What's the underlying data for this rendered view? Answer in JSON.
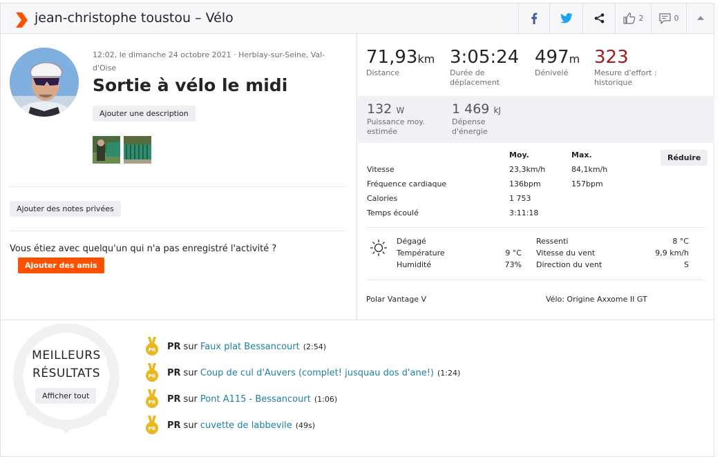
{
  "header": {
    "title": "jean-christophe toustou – Vélo",
    "kudos_count": "2",
    "comments_count": "0"
  },
  "activity": {
    "meta": "12:02, le dimanche 24 octobre 2021 · Herblay-sur-Seine, Val-d'Oise",
    "title": "Sortie à vélo le midi",
    "add_description": "Ajouter une description",
    "add_private_notes": "Ajouter des notes privées",
    "with_question": "Vous étiez avec quelqu'un qui n'a pas enregistré l'activité ?",
    "add_friends": "Ajouter des amis"
  },
  "stats": {
    "distance": {
      "value": "71,93",
      "unit": "km",
      "label": "Distance"
    },
    "moving_time": {
      "value": "3:05:24",
      "label": "Durée de déplacement"
    },
    "elevation": {
      "value": "497",
      "unit": "m",
      "label": "Dénivelé"
    },
    "effort": {
      "value": "323",
      "label": "Mesure d'effort : historique"
    },
    "power": {
      "value": "132",
      "unit": "W",
      "label": "Puissance moy. estimée"
    },
    "energy": {
      "value": "1 469",
      "unit": "kJ",
      "label": "Dépense d'énergie"
    }
  },
  "details": {
    "col_avg": "Moy.",
    "col_max": "Max.",
    "reduce": "Réduire",
    "rows": [
      {
        "label": "Vitesse",
        "avg": "23,3km/h",
        "max": "84,1km/h"
      },
      {
        "label": "Fréquence cardiaque",
        "avg": "136bpm",
        "max": "157bpm"
      },
      {
        "label": "Calories",
        "avg": "1 753",
        "max": ""
      },
      {
        "label": "Temps écoulé",
        "avg": "3:11:18",
        "max": ""
      }
    ]
  },
  "weather": {
    "condition": "Dégagé",
    "temp_label": "Température",
    "temp_value": "9 °C",
    "humidity_label": "Humidité",
    "humidity_value": "73%",
    "feels_label": "Ressenti",
    "feels_value": "8 °C",
    "wind_label": "Vitesse du vent",
    "wind_value": "9,9 km/h",
    "wind_dir_label": "Direction du vent",
    "wind_dir_value": "S"
  },
  "gear": {
    "device": "Polar Vantage V",
    "bike": "Vélo: Origine Axxome II GT"
  },
  "best_results": {
    "title_line1": "MEILLEURS",
    "title_line2": "RÉSULTATS",
    "show_all": "Afficher tout",
    "pr_label": "PR",
    "sur": "sur",
    "items": [
      {
        "segment": "Faux plat Bessancourt",
        "time": "(2:54)"
      },
      {
        "segment": "Coup de cul d'Auvers (complet! jusquau dos d'ane!)",
        "time": "(1:24)"
      },
      {
        "segment": "Pont A115 - Bessancourt",
        "time": "(1:06)"
      },
      {
        "segment": "cuvette de labbevile",
        "time": "(49s)"
      }
    ]
  },
  "colors": {
    "brand": "#fc5200",
    "link": "#1e80a3",
    "effort": "#a21b1b",
    "medal": "#e8b721"
  }
}
